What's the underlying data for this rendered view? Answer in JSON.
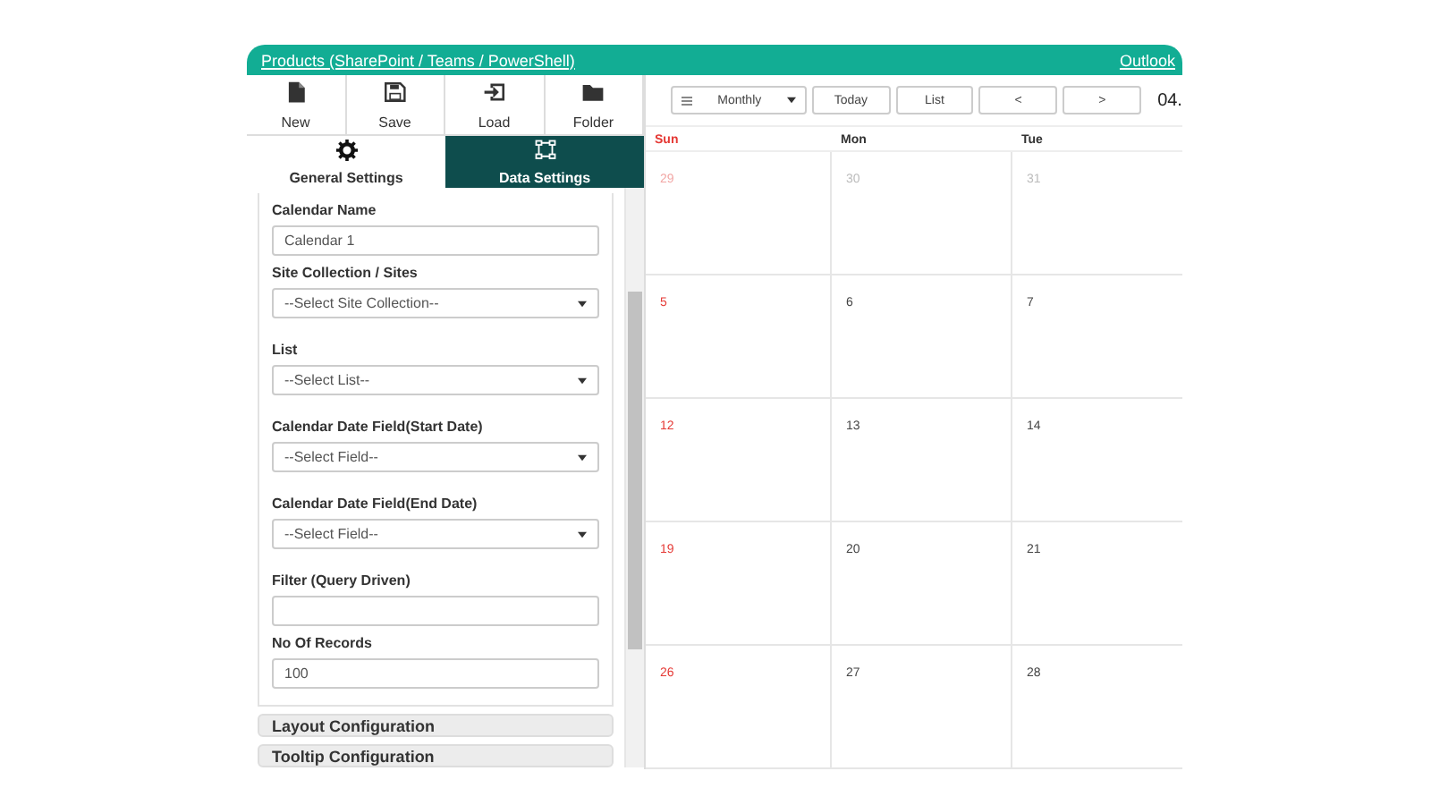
{
  "header": {
    "breadcrumb": "Products (SharePoint / Teams / PowerShell)",
    "link": "Outlook"
  },
  "toolbar": [
    {
      "label": "New",
      "kind": "file"
    },
    {
      "label": "Save",
      "kind": "save"
    },
    {
      "label": "Load",
      "kind": "load"
    },
    {
      "label": "Folder",
      "kind": "folder"
    }
  ],
  "tabs": [
    {
      "label": "General Settings",
      "kind": "gear",
      "selected": false
    },
    {
      "label": "Data Settings",
      "kind": "network",
      "selected": true
    }
  ],
  "form": [
    {
      "label": "Calendar Name",
      "kind": "text",
      "value": "Calendar 1"
    },
    {
      "label": "Site Collection / Sites",
      "kind": "select",
      "value": "--Select Site Collection--"
    },
    {
      "label": "List",
      "kind": "select",
      "value": "--Select List--"
    },
    {
      "label": "Calendar Date Field(Start Date)",
      "kind": "select",
      "value": "--Select Field--"
    },
    {
      "label": "Calendar Date Field(End Date)",
      "kind": "select",
      "value": "--Select Field--"
    },
    {
      "label": "Filter (Query Driven)",
      "kind": "text"
    },
    {
      "label": "No Of Records",
      "kind": "text",
      "value": "100"
    }
  ],
  "sections": [
    {
      "label": "Layout Configuration",
      "expanded": false
    },
    {
      "label": "Tooltip Configuration",
      "expanded": false
    }
  ],
  "calendar": {
    "view": "Monthly",
    "buttons": [
      {
        "label": "Today"
      },
      {
        "label": "List"
      },
      {
        "label": "<"
      },
      {
        "label": ">"
      }
    ],
    "title": "04.",
    "columns": [
      {
        "label": "Sun",
        "weekend": true
      },
      {
        "label": "Mon",
        "weekend": false
      },
      {
        "label": "Tue",
        "weekend": false
      }
    ],
    "weeks": [
      [
        {
          "day": "29",
          "muted": true
        },
        {
          "day": "30",
          "muted": true
        },
        {
          "day": "31",
          "muted": true
        }
      ],
      [
        {
          "day": "5",
          "muted": false
        },
        {
          "day": "6",
          "muted": false
        },
        {
          "day": "7",
          "muted": false
        }
      ],
      [
        {
          "day": "12",
          "muted": false
        },
        {
          "day": "13",
          "muted": false
        },
        {
          "day": "14",
          "muted": false
        }
      ],
      [
        {
          "day": "19",
          "muted": false
        },
        {
          "day": "20",
          "muted": false
        },
        {
          "day": "21",
          "muted": false
        }
      ],
      [
        {
          "day": "26",
          "muted": false
        },
        {
          "day": "27",
          "muted": false
        },
        {
          "day": "28",
          "muted": false
        }
      ]
    ]
  }
}
